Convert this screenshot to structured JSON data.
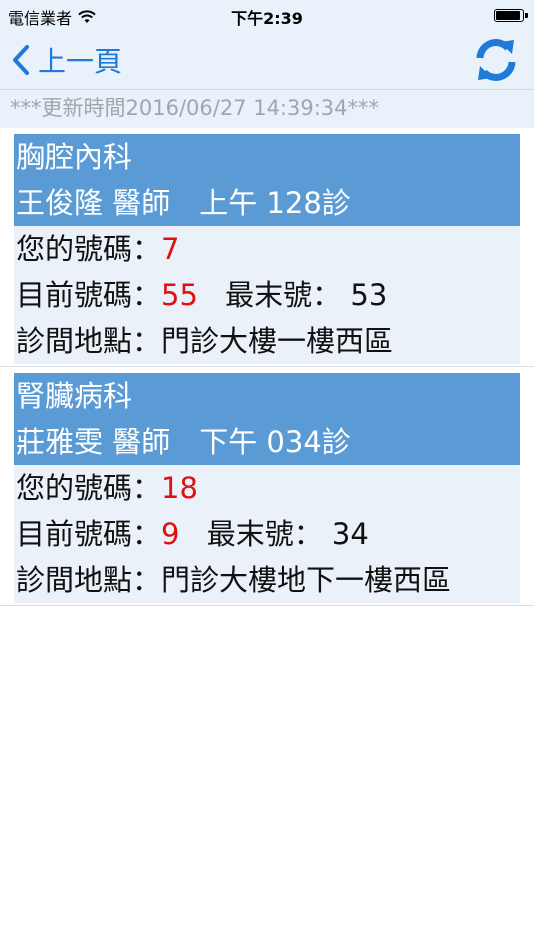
{
  "status_bar": {
    "carrier": "電信業者",
    "time": "下午2:39",
    "battery_level": 0.92
  },
  "nav": {
    "back_label": "上一頁"
  },
  "update_time": "***更新時間2016/06/27 14:39:34***",
  "labels": {
    "your_number": "您的號碼：",
    "current_number": "目前號碼：",
    "last_number": "最末號：",
    "location": "診間地點："
  },
  "cards": [
    {
      "department": "胸腔內科",
      "doctor_line": "王俊隆 醫師　上午 128診",
      "your_number": "7",
      "current_number": "55",
      "last_number": "53",
      "location": "門診大樓一樓西區"
    },
    {
      "department": "腎臟病科",
      "doctor_line": "莊雅雯 醫師　下午 034診",
      "your_number": "18",
      "current_number": "9",
      "last_number": "34",
      "location": "門診大樓地下一樓西區"
    }
  ],
  "colors": {
    "header_bg": "#5b9bd5",
    "card_bg": "#eaf1f9",
    "accent": "#1f7ad8",
    "number_red": "#e01010"
  }
}
